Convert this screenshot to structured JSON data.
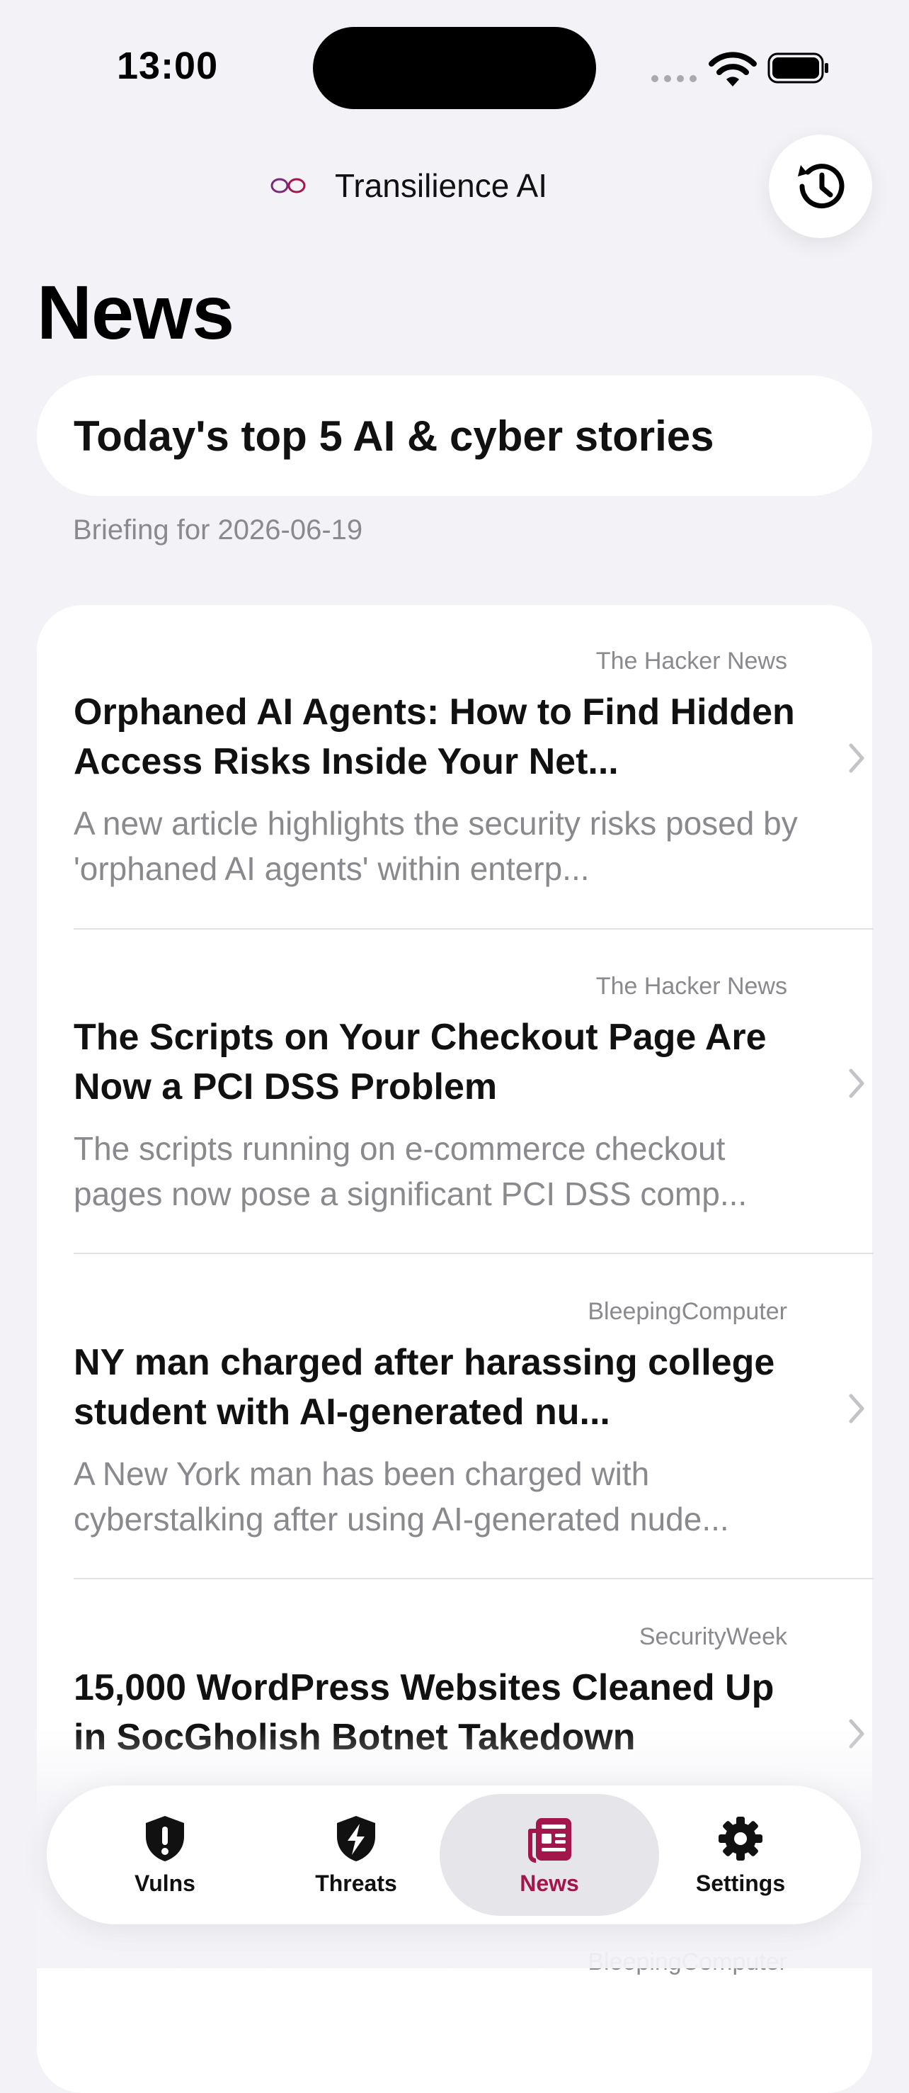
{
  "status_bar": {
    "time": "13:00"
  },
  "header": {
    "app_name": "Transilience AI"
  },
  "page": {
    "title": "News",
    "headline": "Today's top 5 AI & cyber stories",
    "briefing": "Briefing for 2026-06-19"
  },
  "news_items": [
    {
      "source": "The Hacker News",
      "title": "Orphaned AI Agents: How to Find Hidden Access Risks Inside Your Net...",
      "summary": "A new article highlights the security risks posed by 'orphaned AI agents' within enterp..."
    },
    {
      "source": "The Hacker News",
      "title": "The Scripts on Your Checkout Page Are Now a PCI DSS Problem",
      "summary": "The scripts running on e-commerce checkout pages now pose a significant PCI DSS comp..."
    },
    {
      "source": "BleepingComputer",
      "title": "NY man charged after harassing college student with AI-generated nu...",
      "summary": "A New York man has been charged with cyberstalking after using AI-generated nude..."
    },
    {
      "source": "SecurityWeek",
      "title": "15,000 WordPress Websites Cleaned Up in SocGholish Botnet Takedown",
      "summary": ""
    },
    {
      "source": "BleepingComputer",
      "title": "",
      "summary": ""
    }
  ],
  "tabs": [
    {
      "label": "Vulns",
      "icon": "shield-exclamation-icon"
    },
    {
      "label": "Threats",
      "icon": "shield-bolt-icon"
    },
    {
      "label": "News",
      "icon": "newspaper-icon",
      "active": true
    },
    {
      "label": "Settings",
      "icon": "gear-icon"
    }
  ],
  "colors": {
    "accent": "#a3164b",
    "background": "#f2f2f7"
  }
}
